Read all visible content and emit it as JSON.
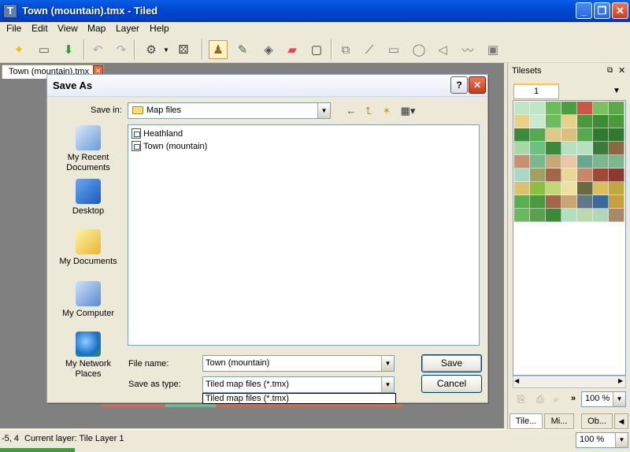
{
  "window": {
    "title": "Town (mountain).tmx - Tiled",
    "app_icon": "T"
  },
  "menu": [
    "File",
    "Edit",
    "View",
    "Map",
    "Layer",
    "Help"
  ],
  "toolbar": {
    "icons": [
      "new-map-icon",
      "open-icon",
      "save-icon",
      "undo-icon",
      "redo-icon",
      "commands-icon",
      "random-mode-icon",
      "stamp-brush-icon",
      "terrain-brush-icon",
      "bucket-fill-icon",
      "eraser-icon",
      "rectangle-select-icon",
      "select-objects-icon",
      "edit-polygons-icon",
      "insert-rectangle-icon",
      "insert-ellipse-icon",
      "insert-polygon-icon",
      "insert-polyline-icon",
      "insert-tile-icon"
    ]
  },
  "document_tab": {
    "label": "Town (mountain).tmx"
  },
  "dialog": {
    "title": "Save As",
    "help": "?",
    "close": "✕",
    "save_in_label": "Save in:",
    "save_in_value": "Map files",
    "places": [
      "My Recent Documents",
      "Desktop",
      "My Documents",
      "My Computer",
      "My Network Places"
    ],
    "files": [
      "Heathland",
      "Town (mountain)"
    ],
    "file_name_label": "File name:",
    "file_name_value": "Town (mountain)",
    "save_as_type_label": "Save as type:",
    "save_as_type_value": "Tiled map files (*.tmx)",
    "save_as_type_dropdown_item": "Tiled map files (*.tmx)",
    "save_button": "Save",
    "cancel_button": "Cancel"
  },
  "tilesets": {
    "title": "Tilesets",
    "tab": "1",
    "zoom": "100 %",
    "bottom_tabs": [
      "Tile...",
      "Mi...",
      "Ob..."
    ]
  },
  "status": {
    "coords": "-5, 4",
    "layer": "Current layer: Tile Layer 1",
    "zoom": "100 %"
  },
  "colors": {
    "titlebar": "#0048d0",
    "workspace": "#808080",
    "dialog_bg": "#ece9d8"
  }
}
